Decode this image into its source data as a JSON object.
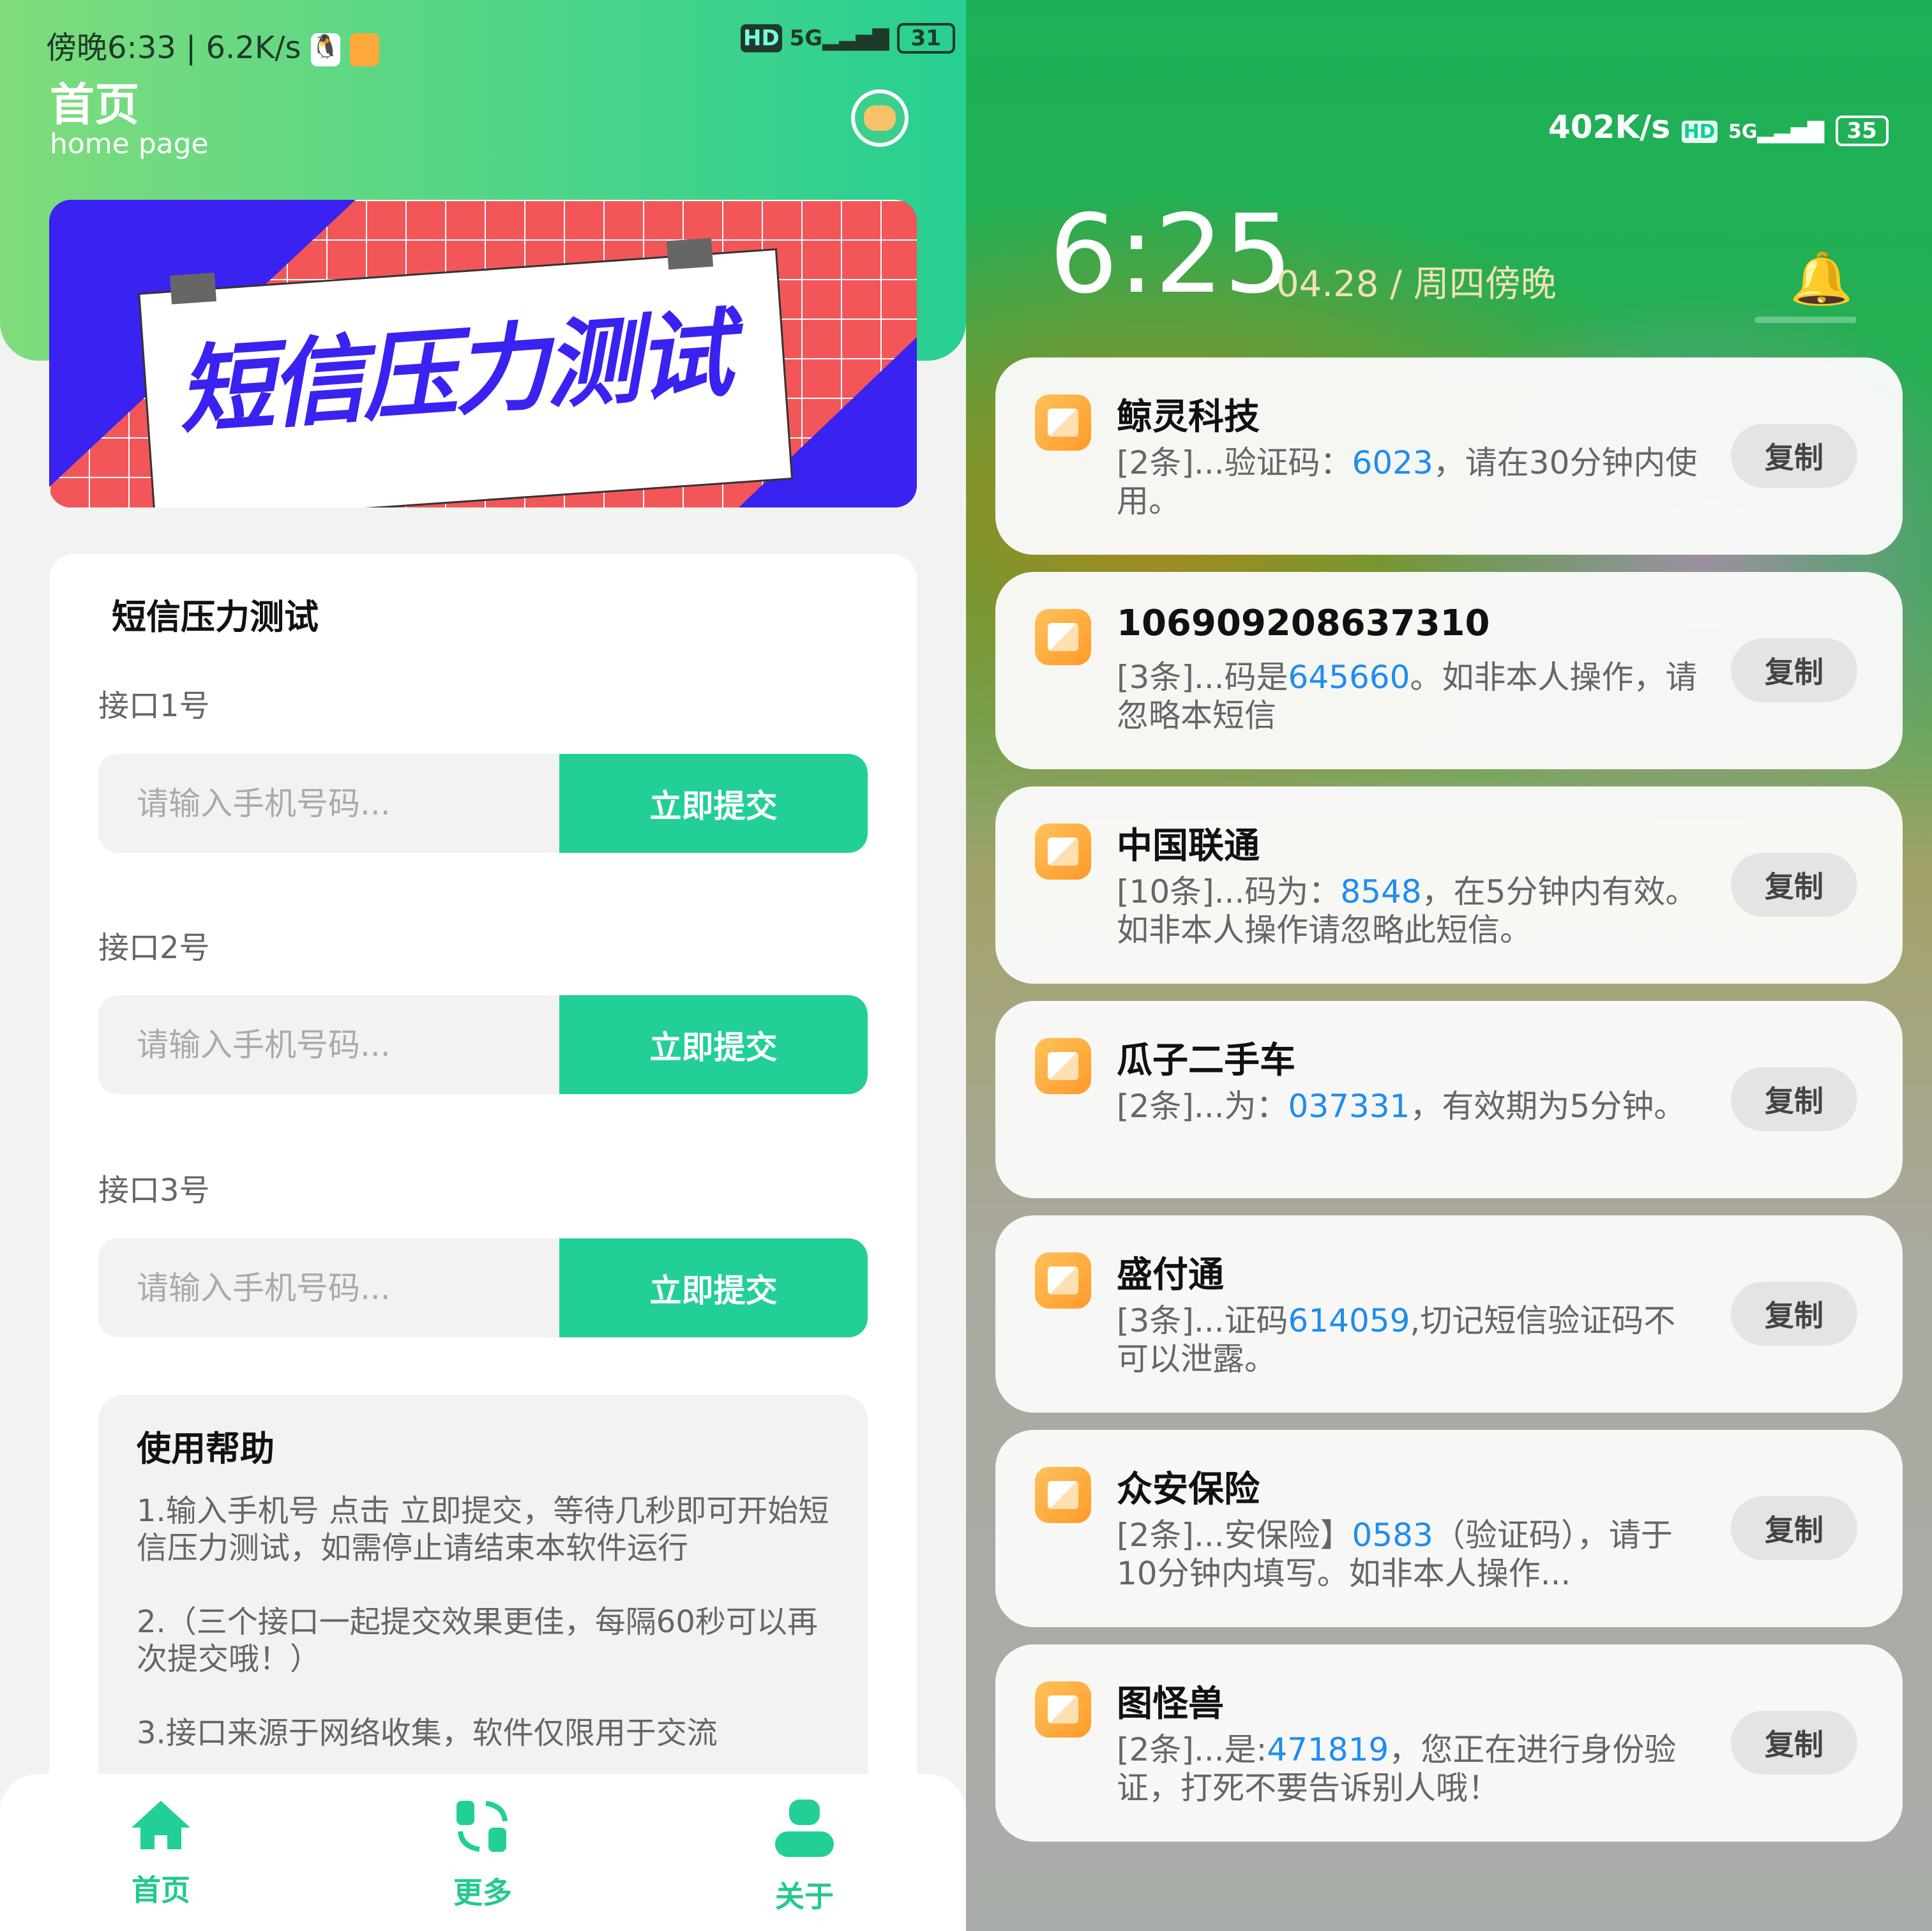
{
  "left": {
    "status": {
      "time": "傍晚6:33",
      "speed": "6.2K/s",
      "battery": "31",
      "network": "5G",
      "hd": "HD"
    },
    "header": {
      "title": "首页",
      "subtitle": "home page"
    },
    "banner": {
      "text": "短信压力测试",
      "colors": {
        "blue": "#3a22f0",
        "red": "#f25658"
      }
    },
    "card": {
      "title": "短信压力测试",
      "interfaces": [
        {
          "label": "接口1号",
          "placeholder": "请输入手机号码...",
          "button": "立即提交"
        },
        {
          "label": "接口2号",
          "placeholder": "请输入手机号码...",
          "button": "立即提交"
        },
        {
          "label": "接口3号",
          "placeholder": "请输入手机号码...",
          "button": "立即提交"
        }
      ]
    },
    "help": {
      "title": "使用帮助",
      "items": [
        "1.输入手机号 点击 立即提交，等待几秒即可开始短信压力测试，如需停止请结束本软件运行",
        "2.（三个接口一起提交效果更佳，每隔60秒可以再次提交哦！）",
        "3.接口来源于网络收集，软件仅限用于交流"
      ]
    },
    "nav": [
      {
        "label": "首页",
        "icon": "home-icon"
      },
      {
        "label": "更多",
        "icon": "swap-icon"
      },
      {
        "label": "关于",
        "icon": "user-icon"
      }
    ],
    "accent": "#22cf96"
  },
  "right": {
    "status": {
      "speed": "402K/s",
      "battery": "35",
      "network": "5G",
      "hd": "HD"
    },
    "clock": {
      "time": "6:25",
      "date": "04.28 / 周四傍晚"
    },
    "notifications": [
      {
        "title": "鲸灵科技",
        "pre": "[2条]...验证码：",
        "code": "6023",
        "post": "，请在30分钟内使用。",
        "copy": "复制"
      },
      {
        "title": "106909208637310",
        "pre": "[3条]...码是",
        "code": "645660",
        "post": "。如非本人操作，请忽略本短信",
        "copy": "复制"
      },
      {
        "title": "中国联通",
        "pre": "[10条]...码为：",
        "code": "8548",
        "post": "，在5分钟内有效。如非本人操作请忽略此短信。",
        "copy": "复制"
      },
      {
        "title": "瓜子二手车",
        "pre": "[2条]...为：",
        "code": "037331",
        "post": "，有效期为5分钟。",
        "copy": "复制"
      },
      {
        "title": "盛付通",
        "pre": "[3条]...证码",
        "code": "614059",
        "post": ",切记短信验证码不可以泄露。",
        "copy": "复制"
      },
      {
        "title": "众安保险",
        "pre": "[2条]...安保险】",
        "code": "0583",
        "post": "（验证码），请于10分钟内填写。如非本人操作...",
        "copy": "复制"
      },
      {
        "title": "图怪兽",
        "pre": "[2条]...是:",
        "code": "471819",
        "post": "，您正在进行身份验证，打死不要告诉别人哦！",
        "copy": "复制"
      }
    ],
    "code_color": "#1f8cf0"
  }
}
